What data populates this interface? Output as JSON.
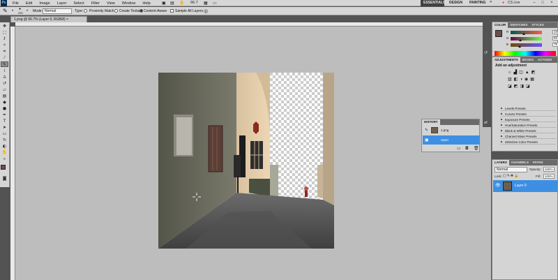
{
  "menubar": {
    "logo": "Ps",
    "items": [
      "File",
      "Edit",
      "Image",
      "Layer",
      "Select",
      "Filter",
      "View",
      "Window",
      "Help"
    ],
    "zoom": "66.7",
    "workspaces": [
      "ESSENTIALS",
      "DESIGN",
      "PAINTING"
    ],
    "cs_live": "CS Live"
  },
  "options": {
    "brush_size": "250",
    "mode_label": "Mode:",
    "mode_value": "Normal",
    "type_label": "Type:",
    "proximity_match": "Proximity Match",
    "create_texture": "Create Texture",
    "content_aware": "Content-Aware",
    "sample_all_layers": "Sample All Layers"
  },
  "document": {
    "tab_title": "1.png @ 66.7% (Layer 0, RGB/8)"
  },
  "color_panel": {
    "tabs": [
      "COLOR",
      "SWATCHES",
      "STYLES"
    ],
    "sliders": [
      {
        "letter": "R",
        "value": "106",
        "level": 0.42
      },
      {
        "letter": "G",
        "value": "80",
        "level": 0.31
      },
      {
        "letter": "B",
        "value": "75",
        "level": 0.29
      }
    ],
    "fg_color": "#6a504b"
  },
  "adjustments_panel": {
    "tabs": [
      "ADJUSTMENTS",
      "MASKS",
      "ACTIONS"
    ],
    "title": "Add an adjustment",
    "presets": [
      "Levels Presets",
      "Curves Presets",
      "Exposure Presets",
      "Hue/Saturation Presets",
      "Black & White Presets",
      "Channel Mixer Presets",
      "Selective Color Presets"
    ]
  },
  "history_panel": {
    "title": "HISTORY",
    "snapshot": "1.png",
    "steps": [
      "Open"
    ]
  },
  "layers_panel": {
    "tabs": [
      "LAYERS",
      "CHANNELS",
      "PATHS"
    ],
    "blend_mode": "Normal",
    "opacity_label": "Opacity:",
    "opacity": "100%",
    "lock_label": "Lock:",
    "fill_label": "Fill:",
    "fill": "100%",
    "layers": [
      "Layer 0"
    ]
  },
  "colors": {
    "selection": "#3d8fe3",
    "chrome": "#d6d6d6",
    "pasteboard": "#bdbdbd"
  }
}
